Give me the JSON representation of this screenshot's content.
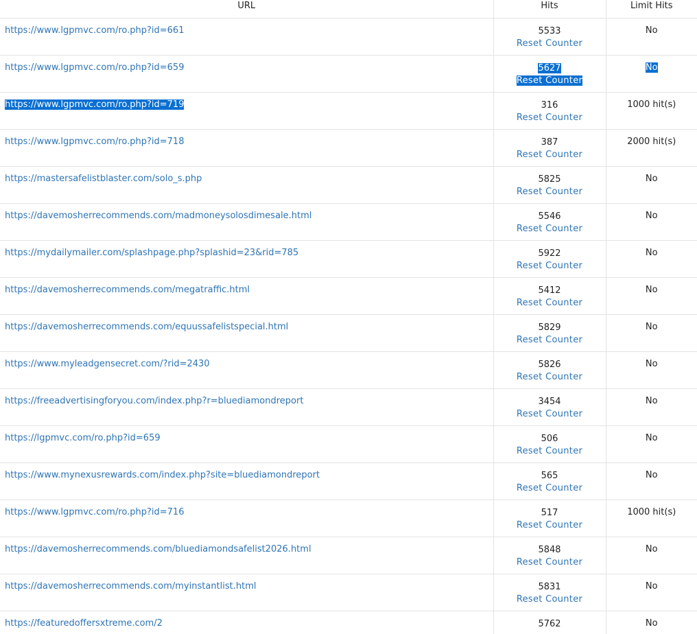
{
  "columns": {
    "url": "URL",
    "hits": "Hits",
    "limit": "Limit Hits"
  },
  "reset_label": "Reset Counter",
  "selection_color": "#0a6fd1",
  "link_color": "#2e74b5",
  "rows": [
    {
      "url": "https://www.lgpmvc.com/ro.php?id=661",
      "hits": "5533",
      "limit": "No"
    },
    {
      "url": "https://www.lgpmvc.com/ro.php?id=659",
      "hits": "5627",
      "limit": "No"
    },
    {
      "url": "https://www.lgpmvc.com/ro.php?id=719",
      "hits": "316",
      "limit": "1000 hit(s)"
    },
    {
      "url": "https://www.lgpmvc.com/ro.php?id=718",
      "hits": "387",
      "limit": "2000 hit(s)"
    },
    {
      "url": "https://mastersafelistblaster.com/solo_s.php",
      "hits": "5825",
      "limit": "No"
    },
    {
      "url": "https://davemosherrecommends.com/madmoneysolosdimesale.html",
      "hits": "5546",
      "limit": "No"
    },
    {
      "url": "https://mydailymailer.com/splashpage.php?splashid=23&rid=785",
      "hits": "5922",
      "limit": "No"
    },
    {
      "url": "https://davemosherrecommends.com/megatraffic.html",
      "hits": "5412",
      "limit": "No"
    },
    {
      "url": "https://davemosherrecommends.com/equussafelistspecial.html",
      "hits": "5829",
      "limit": "No"
    },
    {
      "url": "https://www.myleadgensecret.com/?rid=2430",
      "hits": "5826",
      "limit": "No"
    },
    {
      "url": "https://freeadvertisingforyou.com/index.php?r=bluediamondreport",
      "hits": "3454",
      "limit": "No"
    },
    {
      "url": "https://lgpmvc.com/ro.php?id=659",
      "hits": "506",
      "limit": "No"
    },
    {
      "url": "https://www.mynexusrewards.com/index.php?site=bluediamondreport",
      "hits": "565",
      "limit": "No"
    },
    {
      "url": "https://www.lgpmvc.com/ro.php?id=716",
      "hits": "517",
      "limit": "1000 hit(s)"
    },
    {
      "url": "https://davemosherrecommends.com/bluediamondsafelist2026.html",
      "hits": "5848",
      "limit": "No"
    },
    {
      "url": "https://davemosherrecommends.com/myinstantlist.html",
      "hits": "5831",
      "limit": "No"
    },
    {
      "url": "https://featuredoffersxtreme.com/2",
      "hits": "5762",
      "limit": "No"
    }
  ]
}
